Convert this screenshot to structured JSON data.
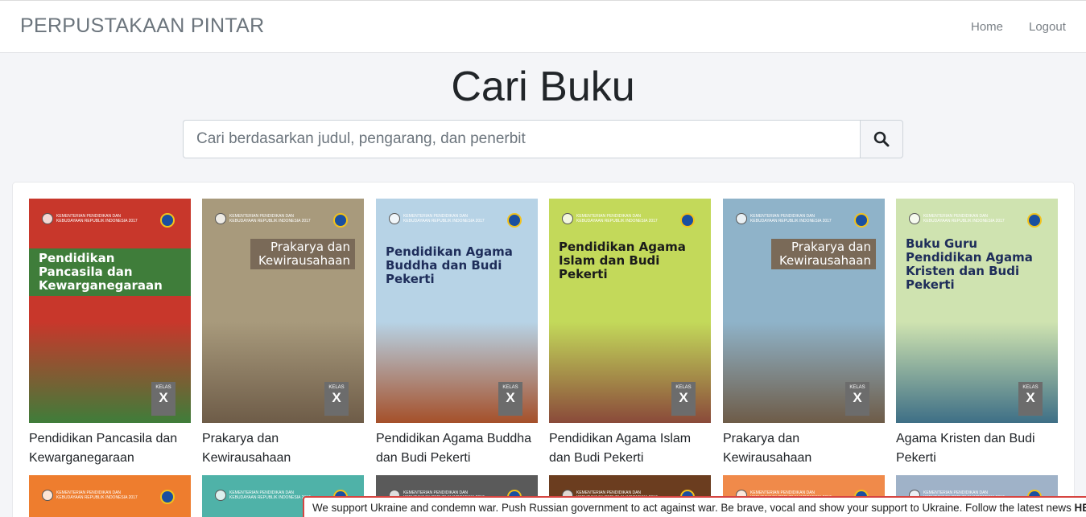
{
  "header": {
    "brand": "PERPUSTAKAAN PINTAR",
    "nav": [
      {
        "label": "Home"
      },
      {
        "label": "Logout"
      }
    ]
  },
  "search": {
    "title": "Cari Buku",
    "placeholder": "Cari berdasarkan judul, pengarang, dan penerbit",
    "value": ""
  },
  "books": [
    {
      "title": "Pendidikan Pancasila dan Kewarganegaraan",
      "cover_title": "Pendidikan Pancasila dan Kewarganegaraan",
      "cover_color": "#c8372b",
      "accent": "#3f7d3a"
    },
    {
      "title": "Prakarya dan Kewirausahaan",
      "cover_title": "Prakarya dan Kewirausahaan",
      "cover_color": "#a89a7c",
      "accent": "#6e5c48"
    },
    {
      "title": "Pendidikan Agama Buddha dan Budi Pekerti",
      "cover_title": "Pendidikan Agama Buddha dan Budi Pekerti",
      "cover_color": "#b7d3e6",
      "accent": "#a5502a"
    },
    {
      "title": "Pendidikan Agama Islam dan Budi Pekerti",
      "cover_title": "Pendidikan Agama Islam dan Budi Pekerti",
      "cover_color": "#c3d95a",
      "accent": "#8a4a3a"
    },
    {
      "title": "Prakarya dan Kewirausahaan",
      "cover_title": "Prakarya dan Kewirausahaan",
      "cover_color": "#8fb3c9",
      "accent": "#6e5c48"
    },
    {
      "title": "Agama Kristen dan Budi Pekerti",
      "cover_title": "Buku Guru Pendidikan Agama Kristen dan Budi Pekerti",
      "cover_color": "#cfe3b0",
      "accent": "#3e6f86"
    }
  ],
  "cover_common": {
    "ministry": "KEMENTERIAN PENDIDIKAN DAN KEBUDAYAAN REPUBLIK INDONESIA 2017",
    "kelas_label": "KELAS",
    "kelas_value": "X"
  },
  "second_row_colors": [
    "#ee7d2e",
    "#4fb2a8",
    "#5a5a5a",
    "#6b3d1f",
    "#f08a4a",
    "#9fb2c8"
  ],
  "banner": {
    "text": "We support Ukraine and condemn war. Push Russian government to act against war. Be brave, vocal and show your support to Ukraine. Follow the latest news ",
    "link": "HERE"
  }
}
